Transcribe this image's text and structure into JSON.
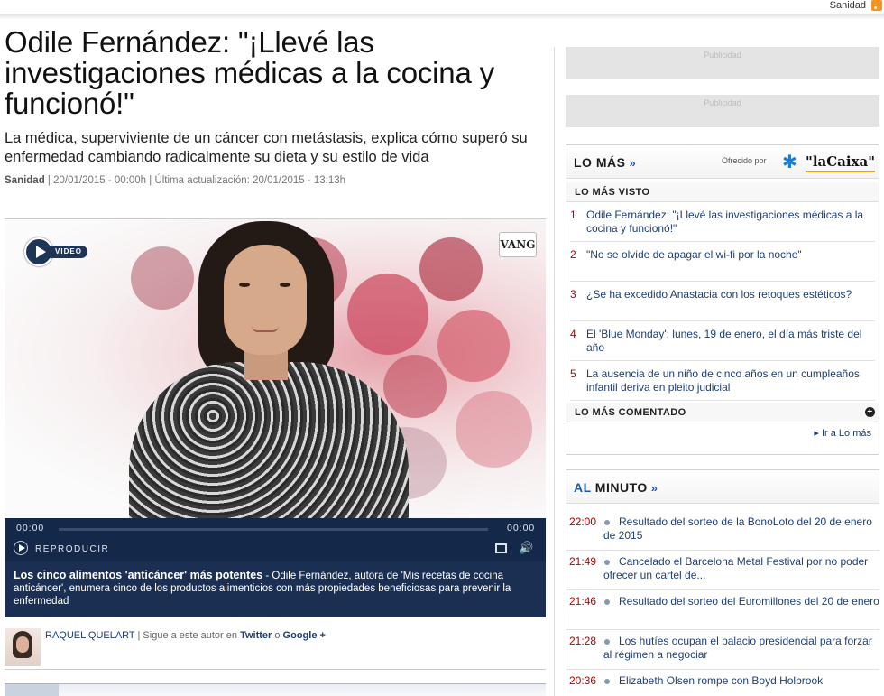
{
  "topbar": {
    "section_link": "Sanidad",
    "rss_icon": "rss-icon"
  },
  "article": {
    "headline": "Odile Fernández: \"¡Llevé las investigaciones médicas a la cocina y funcionó!\"",
    "subtitle": "La médica, superviviente de un cáncer con metástasis, explica cómo superó su enfermedad cambiando radicalmente su dieta y su estilo de vida",
    "section": "Sanidad",
    "date_line": " | 20/01/2015 - 00:00h | Última actualización: 20/01/2015 - 13:13h"
  },
  "video": {
    "badge": "VIDEO",
    "watermark": "VANG",
    "time_current": "00:00",
    "time_total": "00:00",
    "play_label": "REPRODUCIR",
    "progress": 0,
    "caption_title": "Los cinco alimentos 'anticáncer' más potentes",
    "caption_text": " - Odile Fernández, autora de 'Mis recetas de cocina anticáncer', enumera cinco de los productos alimenticios con más propiedades beneficiosas para prevenir la enfermedad"
  },
  "author": {
    "name": "RAQUEL QUELART",
    "follow_text": " | Sigue a este autor en ",
    "twitter": "Twitter",
    "or": " o ",
    "google": "Google +"
  },
  "sidebar": {
    "ads": [
      "Publicidad",
      "Publicidad"
    ],
    "lo_mas": {
      "title": "LO MÁS",
      "chevron": "»",
      "offered_by": "Ofrecido por",
      "sponsor": "\"laCaixa\"",
      "visto_label": "LO MÁS VISTO",
      "items": [
        {
          "num": "1",
          "text": "Odile Fernández: \"¡Llevé las investigaciones médicas a la cocina y funcionó!\""
        },
        {
          "num": "2",
          "text": "\"No se olvide de apagar el wi-fi por la noche\""
        },
        {
          "num": "3",
          "text": "¿Se ha excedido Anastacia con los retoques estéticos?"
        },
        {
          "num": "4",
          "text": "El 'Blue Monday': lunes, 19 de enero, el día más triste del año"
        },
        {
          "num": "5",
          "text": "La ausencia de un niño de cinco años en un cumpleaños infantil deriva en pleito judicial"
        }
      ],
      "comentado_label": "LO MÁS COMENTADO",
      "plus": "+",
      "ir_a": "▸ Ir a Lo más"
    },
    "al_minuto": {
      "title_accent": "AL",
      "title_rest": " MINUTO",
      "chevron": "»",
      "items": [
        {
          "time": "22:00",
          "text": "Resultado del sorteo de la BonoLoto del 20 de enero de 2015"
        },
        {
          "time": "21:49",
          "text": "Cancelado el Barcelona Metal Festival por no poder ofrecer un cartel de..."
        },
        {
          "time": "21:46",
          "text": "Resultado del sorteo del Euromillones del 20 de enero"
        },
        {
          "time": "21:28",
          "text": "Los hutíes ocupan el palacio presidencial para forzar al régimen a negociar"
        },
        {
          "time": "20:36",
          "text": "Elizabeth Olsen rompe con Boyd Holbrook"
        }
      ]
    }
  },
  "colors": {
    "accent": "#1e5aa8",
    "link": "#1f3f73",
    "time_red": "#b30000",
    "player_bg": "#14284a"
  }
}
